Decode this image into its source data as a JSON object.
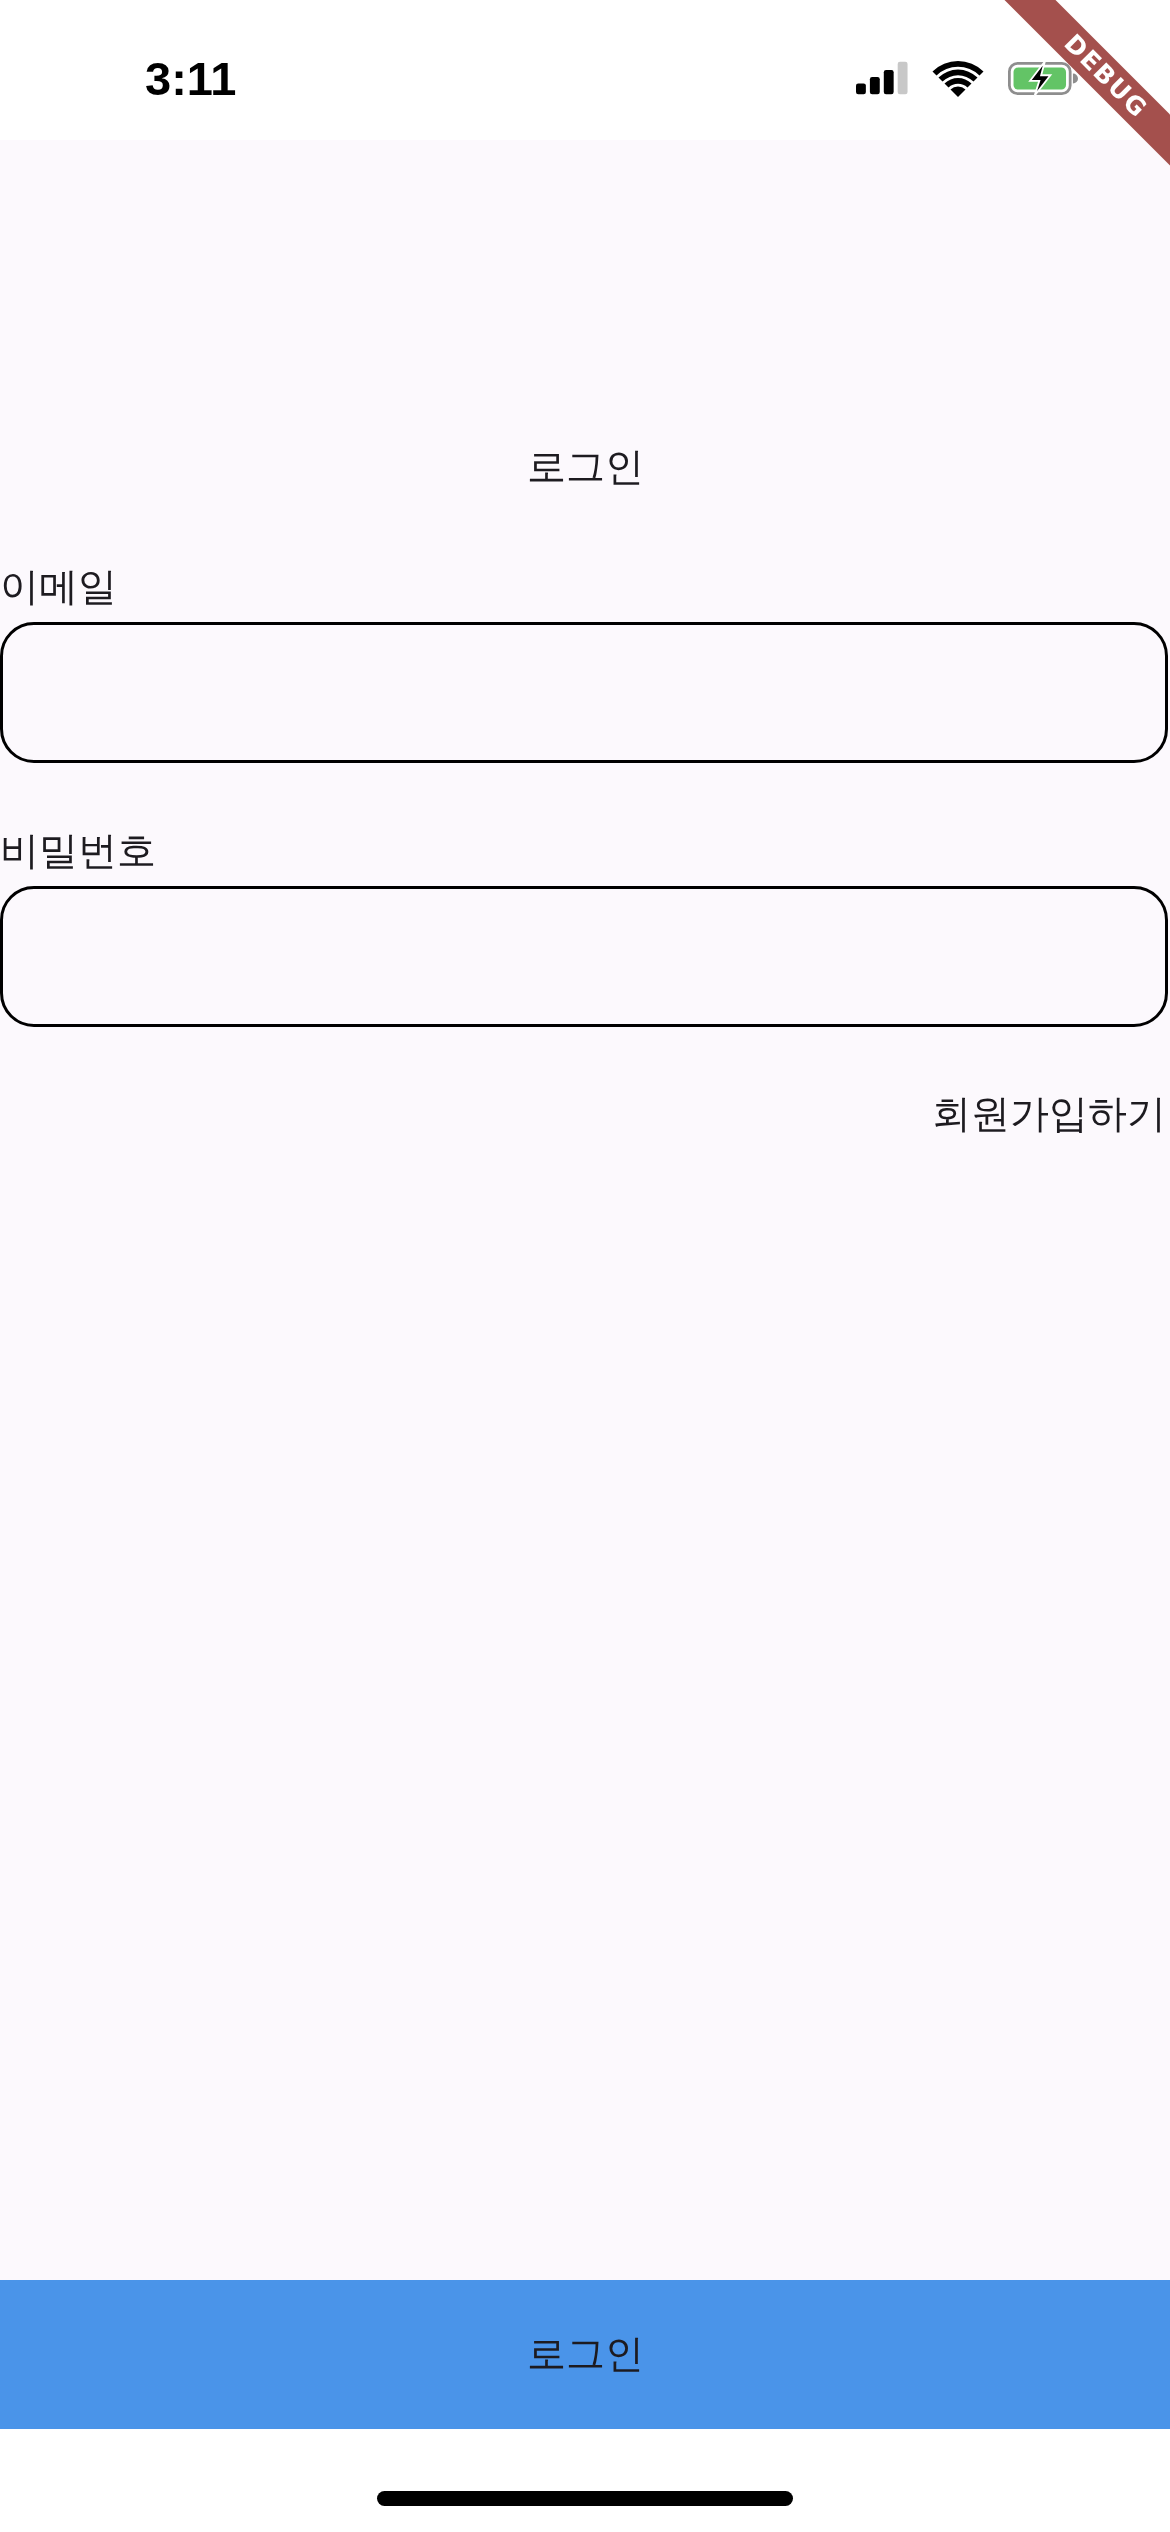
{
  "status_bar": {
    "time": "3:11"
  },
  "debug_banner": {
    "label": "DEBUG"
  },
  "title": "로그인",
  "fields": [
    {
      "label": "이메일"
    },
    {
      "label": "비밀번호"
    }
  ],
  "signup_link": {
    "label": "회원가입하기"
  },
  "login_button": {
    "label": "로그인"
  }
}
